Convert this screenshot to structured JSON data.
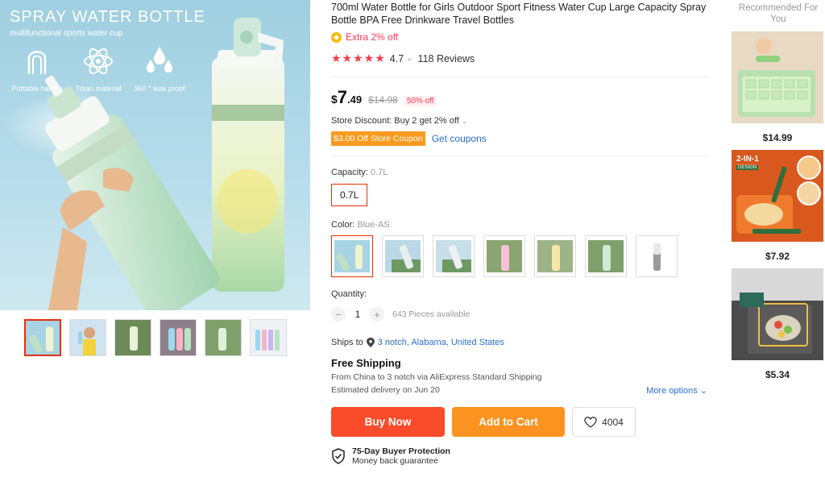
{
  "gallery": {
    "main_title": "SPRAY WATER BOTTLE",
    "main_subtitle": "multifunctional sports water cup",
    "features": [
      {
        "label": "Portable handle",
        "icon": "handle-icon"
      },
      {
        "label": "Tritan material",
        "icon": "atom-icon"
      },
      {
        "label": "360 ° leak proof",
        "icon": "droplets-icon"
      }
    ],
    "thumbnails": [
      {
        "alt": "thumb-1",
        "active": true
      },
      {
        "alt": "thumb-2",
        "active": false
      },
      {
        "alt": "thumb-3",
        "active": false
      },
      {
        "alt": "thumb-4",
        "active": false
      },
      {
        "alt": "thumb-5",
        "active": false
      },
      {
        "alt": "thumb-6",
        "active": false
      }
    ]
  },
  "product": {
    "title": "700ml Water Bottle for Girls Outdoor Sport Fitness Water Cup Large Capacity Spray Bottle BPA Free Drinkware Travel Bottles",
    "extra_off": "Extra 2% off",
    "rating": "4.7",
    "reviews": "118 Reviews",
    "price_currency": "$",
    "price_int": "7",
    "price_dec": ".49",
    "original_price": "$14.98",
    "discount": "50% off",
    "store_discount": "Store Discount: Buy 2 get 2% off",
    "coupon": "$3.00 Off Store Coupon",
    "get_coupons": "Get coupons",
    "capacity_label": "Capacity:",
    "capacity_value": "0.7L",
    "capacity_option": "0.7L",
    "color_label": "Color:",
    "color_value": "Blue-AS",
    "quantity_label": "Quantity:",
    "quantity_value": "1",
    "available": "643 Pieces available",
    "ships_label": "Ships to",
    "ships_location": "3 notch, Alabama, United States",
    "shipping_title": "Free Shipping",
    "shipping_from": "From China to 3 notch via AliExpress Standard Shipping",
    "delivery": "Estimated delivery on Jun 20",
    "more_options": "More options",
    "buy_now": "Buy Now",
    "add_to_cart": "Add to Cart",
    "wishlist_count": "4004",
    "protection_title": "75-Day Buyer Protection",
    "protection_sub": "Money back guarantee"
  },
  "recommended": {
    "header": "Recommended For You",
    "items": [
      {
        "price": "$14.99"
      },
      {
        "price": "$7.92",
        "badge": "2-IN-1",
        "badge_sub": "DESIGN"
      },
      {
        "price": "$5.34"
      }
    ]
  },
  "colors": {
    "accent": "#e62e04",
    "buy": "#fa4b2a",
    "cart": "#fc9321",
    "star": "#fd384f",
    "link": "#2a6fd6"
  }
}
